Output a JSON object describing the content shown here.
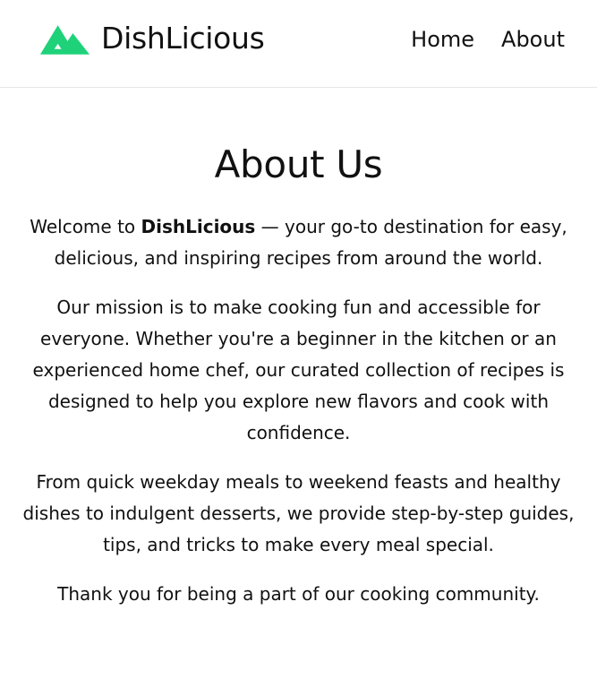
{
  "header": {
    "brand_name": "DishLicious",
    "logo_icon": "mountain-peaks-logo",
    "brand_color": "#1fd27a",
    "nav": [
      {
        "label": "Home"
      },
      {
        "label": "About"
      }
    ]
  },
  "main": {
    "title": "About Us",
    "intro": {
      "prefix": "Welcome to ",
      "brand": "DishLicious",
      "suffix": " — your go-to destination for easy, delicious, and inspiring recipes from around the world."
    },
    "mission": "Our mission is to make cooking fun and accessible for everyone. Whether you're a beginner in the kitchen or an experienced home chef, our curated collection of recipes is designed to help you explore new flavors and cook with confidence.",
    "offerings": "From quick weekday meals to weekend feasts and healthy dishes to indulgent desserts, we provide step-by-step guides, tips, and tricks to make every meal special.",
    "thanks": "Thank you for being a part of our cooking community."
  }
}
